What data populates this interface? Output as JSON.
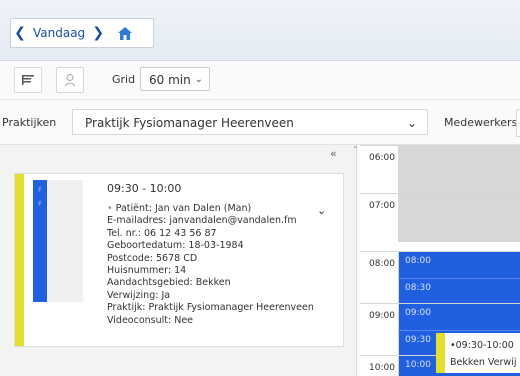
{
  "nav": {
    "label": "Vandaag",
    "prev_icon": "chevron-left-icon",
    "next_icon": "chevron-right-icon",
    "home_icon": "home-icon"
  },
  "toolbar": {
    "grid_label": "Grid",
    "grid_value": "60 min"
  },
  "filters": {
    "praktijken_label": "Praktijken",
    "praktijken_value": "Praktijk Fysiomanager Heerenveen",
    "medewerkers_label": "Medewerkers"
  },
  "card": {
    "time": "09:30 - 10:00",
    "patient": "Patiënt: Jan van Dalen (Man)",
    "email": "E-mailadres: janvandalen@vandalen.fm",
    "tel": "Tel. nr.: 06 12 43 56 87",
    "birth": "Geboortedatum: 18-03-1984",
    "postcode": "Postcode: 5678 CD",
    "huisnummer": "Huisnummer: 14",
    "aandacht": "Aandachtsgebied: Bekken",
    "verwijzing": "Verwijzing: Ja",
    "praktijk": "Praktijk: Praktijk Fysiomanager Heerenveen",
    "videoconsult": "Videoconsult: Nee",
    "blue_marks": [
      "F",
      "F"
    ]
  },
  "calendar": {
    "hours": [
      "06:00",
      "07:00",
      "08:00",
      "09:00",
      "10:00"
    ],
    "slots": [
      "08:00",
      "08:30",
      "09:00",
      "09:30",
      "10:00"
    ],
    "appointment_time": "09:30-10:00",
    "appointment_sub": "Bekken Verwij"
  },
  "colors": {
    "accent_blue": "#1f5fe0",
    "appointment_yellow": "#e3df2e",
    "nav_blue": "#1a4fa0"
  }
}
